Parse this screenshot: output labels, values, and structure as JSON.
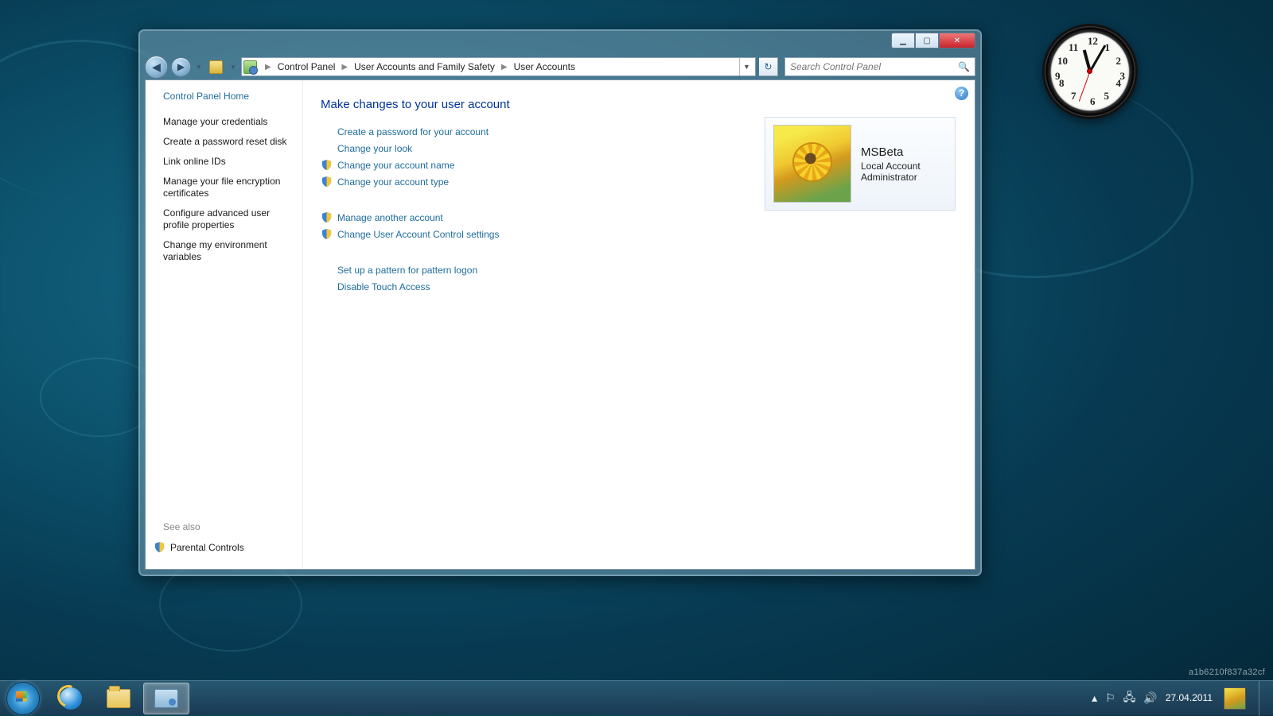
{
  "breadcrumb": {
    "root_icon": "control-panel-icon",
    "items": [
      "Control Panel",
      "User Accounts and Family Safety",
      "User Accounts"
    ]
  },
  "search": {
    "placeholder": "Search Control Panel"
  },
  "sidebar": {
    "home": "Control Panel Home",
    "links": [
      "Manage your credentials",
      "Create a password reset disk",
      "Link online IDs",
      "Manage your file encryption certificates",
      "Configure advanced user profile properties",
      "Change my environment variables"
    ],
    "see_also_label": "See also",
    "see_also_link": "Parental Controls"
  },
  "main": {
    "title": "Make changes to your user account",
    "group1": [
      {
        "label": "Create a password for your account",
        "shield": false
      },
      {
        "label": "Change your look",
        "shield": false
      },
      {
        "label": "Change your account name",
        "shield": true
      },
      {
        "label": "Change your account type",
        "shield": true
      }
    ],
    "group2": [
      {
        "label": "Manage another account",
        "shield": true
      },
      {
        "label": "Change User Account Control settings",
        "shield": true
      }
    ],
    "group3": [
      {
        "label": "Set up a pattern for pattern logon",
        "shield": false
      },
      {
        "label": "Disable Touch Access",
        "shield": false
      }
    ]
  },
  "account": {
    "name": "MSBeta",
    "type": "Local Account",
    "role": "Administrator"
  },
  "tray": {
    "date": "27.04.2011"
  },
  "watermark": "a1b6210f837a32cf"
}
